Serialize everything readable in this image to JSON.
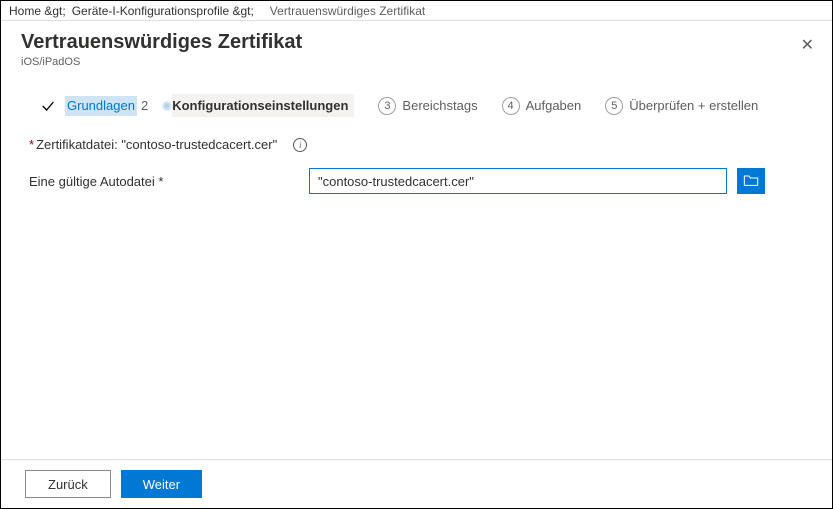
{
  "breadcrumbs": {
    "home": "Home &gt;",
    "devices": "Geräte-I-Konfigurationsprofile &gt;",
    "current": "Vertrauenswürdiges Zertifikat"
  },
  "header": {
    "title": "Vertrauenswürdiges Zertifikat",
    "subtitle": "iOS/iPadOS"
  },
  "close_label": "✕",
  "wizard": {
    "step1": {
      "label": "Grundlagen",
      "label_extra": "2"
    },
    "step2": {
      "label": "Konfigurationseinstellungen"
    },
    "step3": {
      "num": "3",
      "label": "Bereichstags"
    },
    "step4": {
      "num": "4",
      "label": "Aufgaben"
    },
    "step5": {
      "num": "5",
      "label": "Überprüfen + erstellen"
    }
  },
  "form": {
    "required_mark": "*",
    "cert_label": " Zertifikatdatei: \"contoso-trustedcacert.cer\"",
    "info_glyph": "i",
    "file_label": "Eine gültige Autodatei *",
    "file_value": "\"contoso-trustedcacert.cer\""
  },
  "footer": {
    "back": "Zurück",
    "next": "Weiter"
  }
}
